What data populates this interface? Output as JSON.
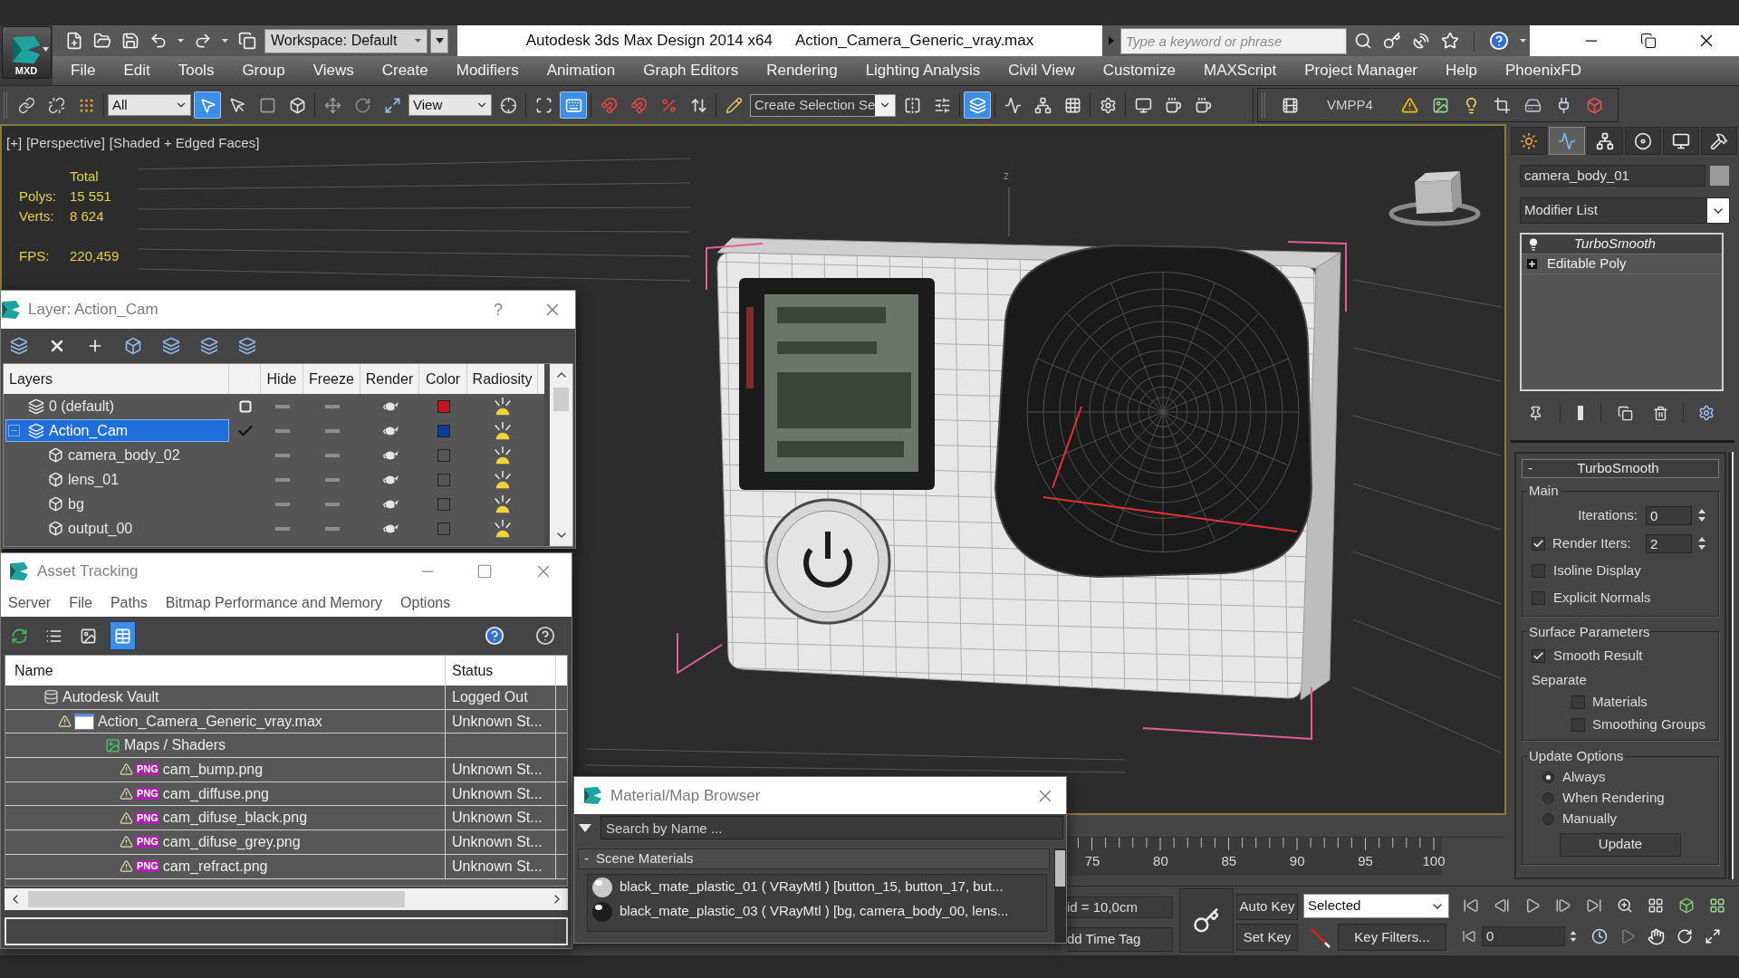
{
  "title_bar": {
    "logo_label": "MXD",
    "workspace": "Workspace: Default",
    "app_title": "Autodesk 3ds Max Design 2014 x64",
    "file_name": "Action_Camera_Generic_vray.max",
    "search": {
      "placeholder": "Type a keyword or phrase"
    }
  },
  "menu_bar": [
    "File",
    "Edit",
    "Tools",
    "Group",
    "Views",
    "Create",
    "Modifiers",
    "Animation",
    "Graph Editors",
    "Rendering",
    "Lighting Analysis",
    "Civil View",
    "Customize",
    "MAXScript",
    "Project Manager",
    "Help",
    "PhoenixFD"
  ],
  "main_toolbar": [
    [
      {
        "kind": "tool",
        "selected": false
      },
      {
        "kind": "tool",
        "selected": false
      },
      {
        "kind": "tool",
        "selected": false
      }
    ],
    [
      {
        "kind": "dropdown",
        "value": "All"
      },
      {
        "kind": "tool",
        "selected": true
      },
      {
        "kind": "tool",
        "selected": false
      },
      {
        "kind": "tool",
        "selected": false
      },
      {
        "kind": "tool",
        "selected": false
      }
    ],
    [
      {
        "kind": "tool",
        "selected": false
      },
      {
        "kind": "tool",
        "selected": false
      },
      {
        "kind": "tool",
        "selected": false
      },
      {
        "kind": "dropdown",
        "value": "View"
      },
      {
        "kind": "tool",
        "selected": false
      }
    ],
    [
      {
        "kind": "tool",
        "selected": false
      },
      {
        "kind": "tool",
        "selected": true
      }
    ],
    [
      {
        "kind": "tool",
        "selected": false
      },
      {
        "kind": "tool",
        "selected": false
      },
      {
        "kind": "tool",
        "selected": false
      },
      {
        "kind": "tool",
        "selected": false
      }
    ],
    [
      {
        "kind": "tool",
        "selected": false
      },
      {
        "kind": "combo",
        "value": "Create Selection Se"
      },
      {
        "kind": "tool",
        "selected": false
      },
      {
        "kind": "tool",
        "selected": false
      }
    ],
    [
      {
        "kind": "tool",
        "selected": true
      }
    ],
    [
      {
        "kind": "tool",
        "selected": false
      },
      {
        "kind": "tool",
        "selected": false
      },
      {
        "kind": "tool",
        "selected": false
      }
    ],
    [
      {
        "kind": "tool",
        "selected": false
      }
    ],
    [
      {
        "kind": "tool",
        "selected": false
      },
      {
        "kind": "tool",
        "selected": false
      },
      {
        "kind": "tool",
        "selected": false
      }
    ]
  ],
  "plugin_toolbar": [
    {
      "kind": "tool",
      "selected": false
    },
    {
      "kind": "label",
      "text": "VMPP4"
    },
    {
      "kind": "tool",
      "selected": false
    },
    {
      "kind": "tool",
      "selected": false
    },
    {
      "kind": "tool",
      "selected": false
    },
    {
      "kind": "tool",
      "selected": false
    },
    {
      "kind": "tool",
      "selected": false
    },
    {
      "kind": "tool",
      "selected": false
    },
    {
      "kind": "tool",
      "selected": false
    }
  ],
  "viewport": {
    "labels": [
      "[+]",
      "[Perspective]",
      "[Shaded + Edged Faces]"
    ],
    "stats": {
      "heading": "Total",
      "rows": [
        {
          "label": "Polys:",
          "value": "15 551"
        },
        {
          "label": "Verts:",
          "value": "8 624"
        }
      ],
      "fps": {
        "label": "FPS:",
        "value": "220,459"
      }
    },
    "axis_label": "z"
  },
  "layer_dialog": {
    "title": "Layer: Action_Cam",
    "help": "?",
    "columns": [
      "Layers",
      "Hide",
      "Freeze",
      "Render",
      "Color",
      "Radiosity"
    ],
    "rows": [
      {
        "name": "0 (default)",
        "kind": "layer",
        "selected": false,
        "current": false,
        "color": "#c4161c"
      },
      {
        "name": "Action_Cam",
        "kind": "layer",
        "selected": true,
        "current": true,
        "expanded": true,
        "color": "#0a3d9c",
        "children": [
          {
            "name": "camera_body_02",
            "kind": "object",
            "selected": false
          },
          {
            "name": "lens_01",
            "kind": "object",
            "selected": false
          },
          {
            "name": "bg",
            "kind": "object",
            "selected": false
          },
          {
            "name": "output_00",
            "kind": "object",
            "selected": false
          }
        ]
      }
    ]
  },
  "asset_tracking": {
    "title": "Asset Tracking",
    "menu": [
      "Server",
      "File",
      "Paths",
      "Bitmap Performance and Memory",
      "Options"
    ],
    "toolbar": [
      {
        "selected": false
      },
      {
        "selected": false
      },
      {
        "selected": false
      },
      {
        "selected": true
      }
    ],
    "columns": [
      "Name",
      "Status"
    ],
    "rows": [
      {
        "name": "Autodesk Vault",
        "kind": "vault",
        "warning": false,
        "status": "Logged Out",
        "children": [
          {
            "name": "Action_Camera_Generic_vray.max",
            "kind": "scene",
            "warning": true,
            "status": "Unknown St...",
            "children": [
              {
                "name": "Maps / Shaders",
                "kind": "folder",
                "warning": false,
                "children": [
                  {
                    "name": "cam_bump.png",
                    "kind": "png",
                    "badge": "PNG",
                    "warning": true,
                    "status": "Unknown St..."
                  },
                  {
                    "name": "cam_diffuse.png",
                    "kind": "png",
                    "badge": "PNG",
                    "warning": true,
                    "status": "Unknown St..."
                  },
                  {
                    "name": "cam_difuse_black.png",
                    "kind": "png",
                    "badge": "PNG",
                    "warning": true,
                    "status": "Unknown St..."
                  },
                  {
                    "name": "cam_difuse_grey.png",
                    "kind": "png",
                    "badge": "PNG",
                    "warning": true,
                    "status": "Unknown St..."
                  },
                  {
                    "name": "cam_refract.png",
                    "kind": "png",
                    "badge": "PNG",
                    "warning": true,
                    "status": "Unknown St..."
                  }
                ]
              }
            ]
          }
        ]
      }
    ]
  },
  "material_browser": {
    "title": "Material/Map Browser",
    "search": {
      "placeholder": "Search by Name ..."
    },
    "group": {
      "toggle": "-",
      "label": "Scene Materials"
    },
    "items": [
      {
        "label": "black_mate_plastic_01 ( VRayMtl ) [button_15, button_17, but...",
        "color": "#c9c9c9"
      },
      {
        "label": "black_mate_plastic_03 ( VRayMtl ) [bg, camera_body_00, lens...",
        "color": "#1e1e1e"
      }
    ]
  },
  "command_panel": {
    "tabs": [
      {
        "selected": false
      },
      {
        "selected": true
      },
      {
        "selected": false
      },
      {
        "selected": false
      },
      {
        "selected": false
      },
      {
        "selected": false
      }
    ],
    "object_name": "camera_body_01",
    "modifier_list": "Modifier List",
    "stack": [
      {
        "label": "TurboSmooth",
        "kind": "modifier",
        "selected": true
      },
      {
        "label": "Editable Poly",
        "kind": "base",
        "selected": false
      }
    ],
    "rollout": {
      "toggle": "-",
      "title": "TurboSmooth",
      "groups": [
        {
          "title": "Main",
          "controls": [
            {
              "kind": "spinner",
              "label": "Iterations:",
              "value": "0"
            },
            {
              "kind": "check_spinner",
              "label": "Render Iters:",
              "checked": true,
              "value": "2"
            },
            {
              "kind": "checkbox",
              "label": "Isoline Display",
              "checked": false
            },
            {
              "kind": "checkbox",
              "label": "Explicit Normals",
              "checked": false
            }
          ]
        },
        {
          "title": "Surface Parameters",
          "controls": [
            {
              "kind": "checkbox",
              "label": "Smooth Result",
              "checked": true
            },
            {
              "kind": "text",
              "label": "Separate"
            },
            {
              "kind": "sub_checkbox",
              "label": "Materials",
              "checked": false
            },
            {
              "kind": "sub_checkbox",
              "label": "Smoothing Groups",
              "checked": false
            }
          ]
        },
        {
          "title": "Update Options",
          "controls": [
            {
              "kind": "radio",
              "label": "Always",
              "selected": true
            },
            {
              "kind": "radio",
              "label": "When Rendering",
              "selected": false
            },
            {
              "kind": "radio",
              "label": "Manually",
              "selected": false
            },
            {
              "kind": "button",
              "label": "Update"
            }
          ]
        }
      ]
    }
  },
  "timeline": {
    "labels": [
      "75",
      "80",
      "85",
      "90",
      "95",
      "100"
    ]
  },
  "status_bar": {
    "grid": "id = 10,0cm",
    "time_tag": "dd Time Tag",
    "auto_key": "Auto Key",
    "set_key": "Set Key",
    "key_mode": "Selected",
    "key_filters": "Key Filters...",
    "frame": "0"
  }
}
